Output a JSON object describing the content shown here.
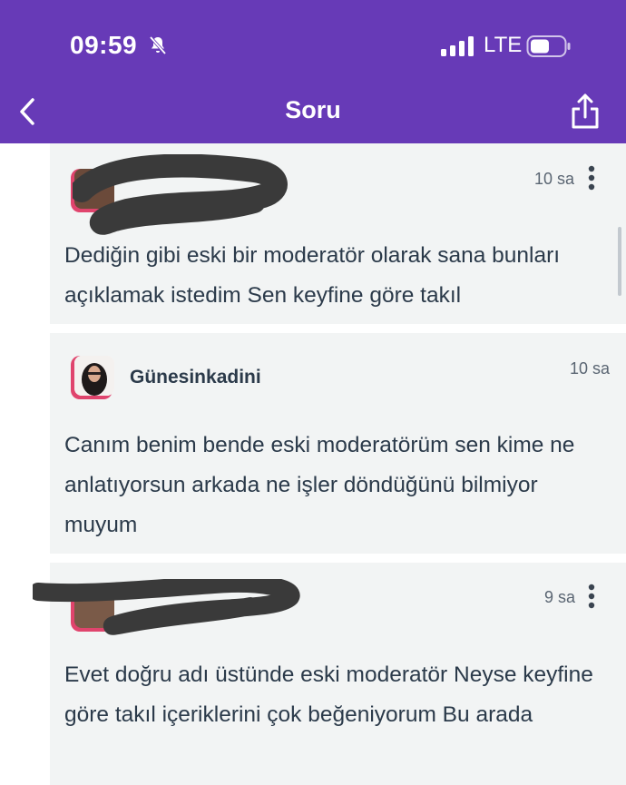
{
  "colors": {
    "accent": "#673ab7",
    "badge": "#e0446d",
    "text": "#2b3a4a"
  },
  "status_bar": {
    "time": "09:59",
    "network": "LTE",
    "icons": [
      "bell-slash-icon",
      "signal-icon",
      "battery-icon"
    ]
  },
  "header": {
    "title": "Soru",
    "back_icon": "chevron-left-icon",
    "share_icon": "share-icon"
  },
  "comments": [
    {
      "username": "",
      "time": "10 sa",
      "text": "Dediğin gibi eski bir moderatör olarak sana bunları açıklamak istedim Sen keyfine göre takıl"
    },
    {
      "username": "Günesinkadini",
      "time": "10 sa",
      "text": "Canım benim bende eski moderatörüm sen kime ne anlatıyorsun arkada ne işler döndüğünü bilmiyor muyum"
    },
    {
      "username": "",
      "time": "9 sa",
      "text": "Evet doğru adı üstünde eski moderatör Neyse keyfine göre takıl içeriklerini çok beğeniyorum Bu arada"
    }
  ]
}
